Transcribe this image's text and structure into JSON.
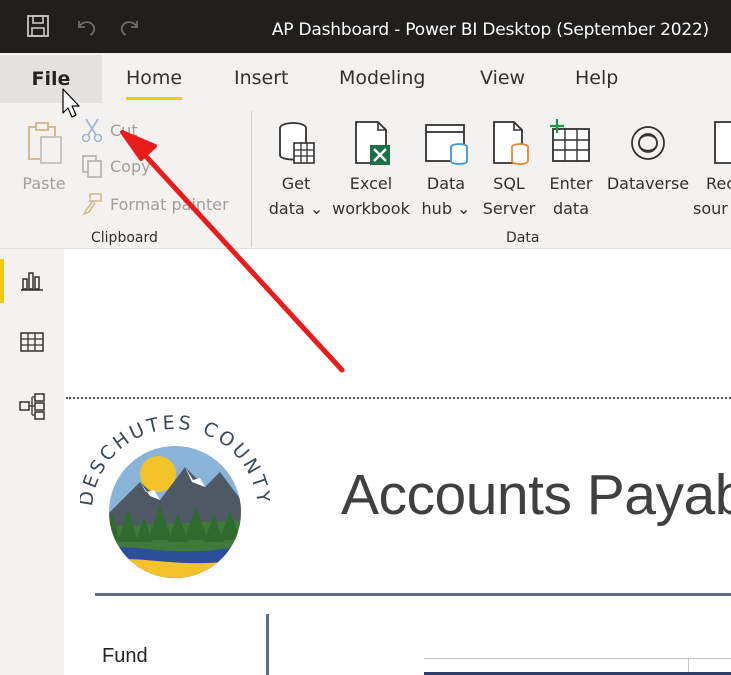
{
  "window": {
    "title": "AP Dashboard - Power BI Desktop (September 2022)"
  },
  "quick_access": {
    "save_icon": "save-icon",
    "undo_icon": "undo-icon",
    "redo_icon": "redo-icon"
  },
  "tabs": [
    {
      "label": "File"
    },
    {
      "label": "Home",
      "active": true
    },
    {
      "label": "Insert"
    },
    {
      "label": "Modeling"
    },
    {
      "label": "View"
    },
    {
      "label": "Help"
    }
  ],
  "ribbon": {
    "clipboard": {
      "group_label": "Clipboard",
      "paste": "Paste",
      "cut": "Cut",
      "copy": "Copy",
      "format_painter": "Format painter"
    },
    "data": {
      "group_label": "Data",
      "get_data": [
        "Get",
        "data ⌄"
      ],
      "excel": [
        "Excel",
        "workbook"
      ],
      "data_hub": [
        "Data",
        "hub ⌄"
      ],
      "sql_server": [
        "SQL",
        "Server"
      ],
      "enter_data": [
        "Enter",
        "data"
      ],
      "dataverse": [
        "Dataverse"
      ],
      "recent_sources": [
        "Rec",
        "sour"
      ]
    }
  },
  "views": [
    {
      "name": "report-view-icon",
      "active": true
    },
    {
      "name": "data-view-icon",
      "active": false
    },
    {
      "name": "model-view-icon",
      "active": false
    }
  ],
  "report": {
    "logo_text": "DESCHUTES COUNTY",
    "title": "Accounts Payabl",
    "fund_label": "Fund"
  },
  "colors": {
    "titlebar": "#201f1e",
    "accent": "#f2c811",
    "annotation_arrow": "#e81c1c",
    "divider": "#5a6c8c"
  }
}
